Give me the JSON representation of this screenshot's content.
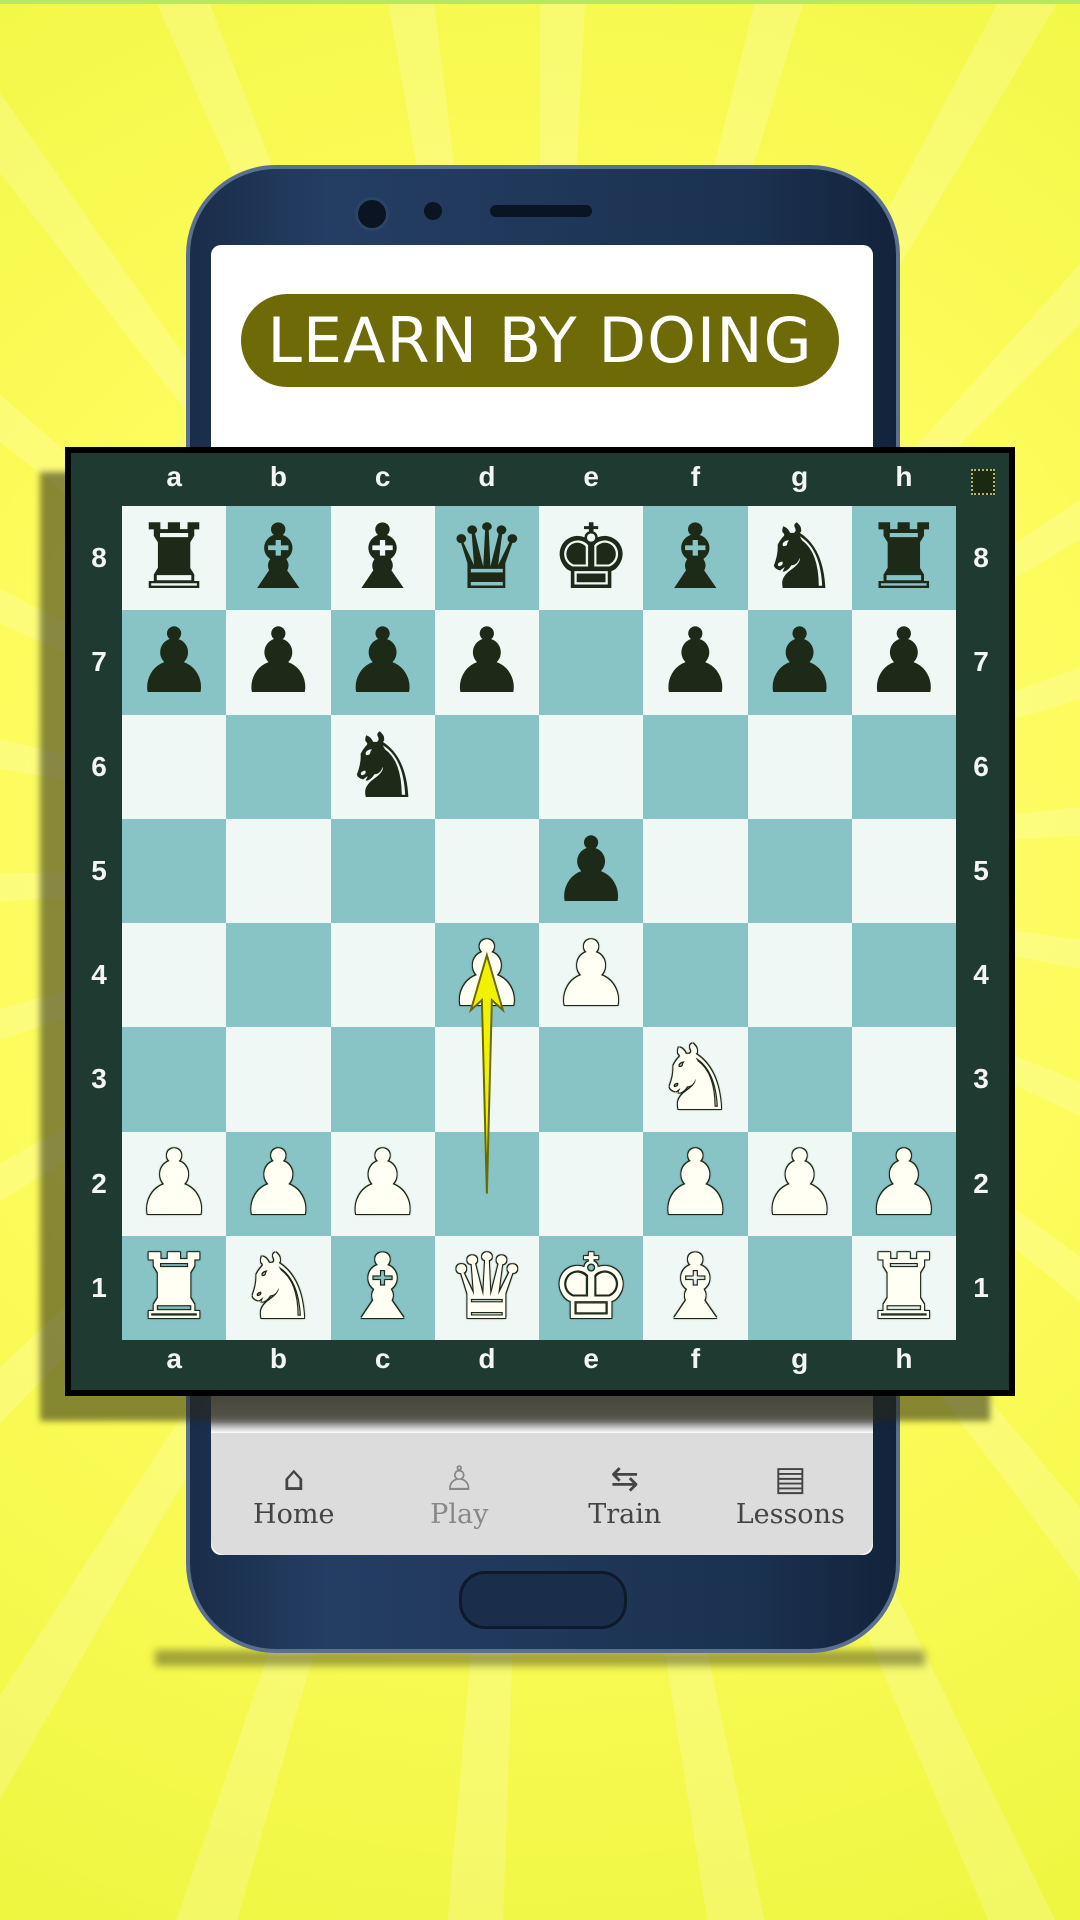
{
  "banner": {
    "text": "LEARN BY DOING",
    "color": "#6e6a08"
  },
  "board": {
    "files": [
      "a",
      "b",
      "c",
      "d",
      "e",
      "f",
      "g",
      "h"
    ],
    "ranks": [
      "8",
      "7",
      "6",
      "5",
      "4",
      "3",
      "2",
      "1"
    ],
    "position": [
      "rbbqkbnr",
      "ppppxppp",
      "xxnxxxxx",
      "xxxxpxxx",
      "xxxPPxxx",
      "xxxxxNxx",
      "PPPxxPPP",
      "RNBQKBxR"
    ],
    "arrow": {
      "from": "d2",
      "to": "d4",
      "color": "#f2f200"
    },
    "light_color": "#f0f8f6",
    "dark_color": "#88c4c6"
  },
  "nav": {
    "items": [
      {
        "label": "Home",
        "icon": "home-icon",
        "glyph": "⌂"
      },
      {
        "label": "Play",
        "icon": "pawn-icon",
        "glyph": "♙"
      },
      {
        "label": "Train",
        "icon": "swap-arrows-icon",
        "glyph": "⇆"
      },
      {
        "label": "Lessons",
        "icon": "book-icon",
        "glyph": "▤"
      }
    ]
  }
}
